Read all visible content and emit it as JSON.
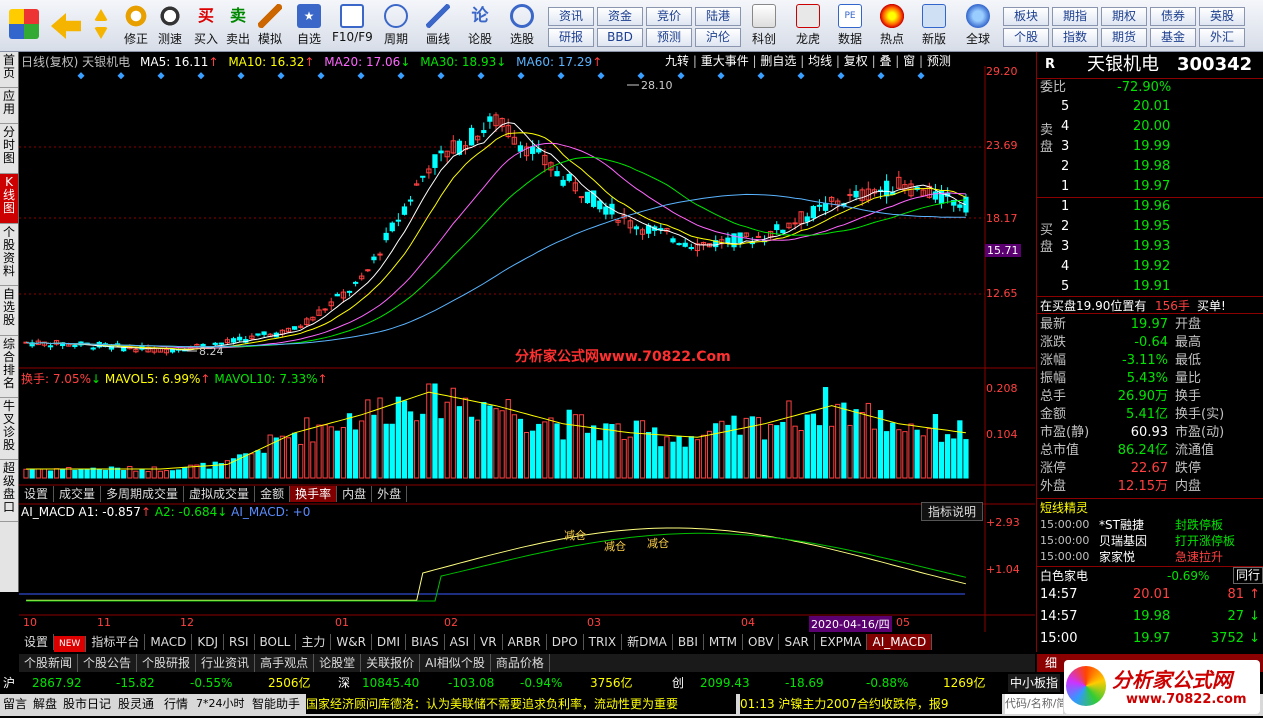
{
  "toolbar": {
    "buttons": [
      "修正",
      "测速",
      "买入",
      "卖出",
      "模拟",
      "自选",
      "F10/F9",
      "周期",
      "画线",
      "论股",
      "选股",
      "科创",
      "龙虎",
      "数据",
      "热点",
      "新版",
      "全球"
    ],
    "quick_row1": [
      "资讯",
      "资金",
      "竞价",
      "陆港",
      "板块",
      "期指",
      "期权",
      "债券",
      "英股"
    ],
    "quick_row2": [
      "研报",
      "BBD",
      "预测",
      "沪伦",
      "个股",
      "指数",
      "期货",
      "基金",
      "外汇"
    ]
  },
  "leftnav": [
    "首页",
    "应用",
    "分时图",
    "K线图",
    "个股资料",
    "自选股",
    "综合排名",
    "牛叉诊股",
    "超级盘口"
  ],
  "chart": {
    "header": {
      "name": "日线(复权) 天银机电",
      "ma5": "MA5: 16.11",
      "ma10": "MA10: 16.32",
      "ma20": "MA20: 17.06",
      "ma30": "MA30: 18.93",
      "ma60": "MA60: 17.29"
    },
    "top_buttons": [
      "九转",
      "重大事件",
      "删自选",
      "均线",
      "复权",
      "叠",
      "窗",
      "预测"
    ],
    "price_axis": [
      "29.20",
      "23.69",
      "18.17",
      "15.71",
      "12.65"
    ],
    "annotations": {
      "high": "28.10",
      "low": "8.24",
      "watermark": "分析家公式网www.70822.Com"
    },
    "volume_header": {
      "a": "换手: 7.05%",
      "b": "MAVOL5: 6.99%",
      "c": "MAVOL10: 7.33%"
    },
    "volume_axis": [
      "0.208",
      "0.104"
    ],
    "volume_tabs": [
      "设置",
      "成交量",
      "多周期成交量",
      "虚拟成交量",
      "金额",
      "换手率",
      "内盘",
      "外盘"
    ],
    "macd_header": {
      "title": "AI_MACD",
      "a1": "A1: -0.857",
      "a2": "A2: -0.684",
      "aim": "AI_MACD: +0"
    },
    "macd_button": "指标说明",
    "macd_axis": [
      "+2.93",
      "+1.04"
    ],
    "macd_labels": [
      "减仓",
      "减仓",
      "减仓"
    ],
    "date_axis": [
      "10",
      "11",
      "12",
      "01",
      "02",
      "03",
      "04",
      "05"
    ],
    "date_highlight": "2020-04-16/四",
    "indicator_tabs": [
      "设置",
      "NEW",
      "指标平台",
      "MACD",
      "KDJ",
      "RSI",
      "BOLL",
      "主力",
      "W&R",
      "DMI",
      "BIAS",
      "ASI",
      "VR",
      "ARBR",
      "DPO",
      "TRIX",
      "新DMA",
      "BBI",
      "MTM",
      "OBV",
      "SAR",
      "EXPMA",
      "AI_MACD"
    ],
    "news_tabs": [
      "个股新闻",
      "个股公告",
      "个股研报",
      "行业资讯",
      "高手观点",
      "论股堂",
      "关联报价",
      "AI相似个股",
      "商品价格"
    ]
  },
  "rpanel": {
    "title": "天银机电",
    "code": "300342",
    "r": "R",
    "weibi_label": "委比",
    "weibi": "-72.90%",
    "sell_label": "卖盘",
    "buy_label": "买盘",
    "asks": [
      {
        "n": "5",
        "p": "20.01"
      },
      {
        "n": "4",
        "p": "20.00"
      },
      {
        "n": "3",
        "p": "19.99"
      },
      {
        "n": "2",
        "p": "19.98"
      },
      {
        "n": "1",
        "p": "19.97"
      }
    ],
    "bids": [
      {
        "n": "1",
        "p": "19.96"
      },
      {
        "n": "2",
        "p": "19.95"
      },
      {
        "n": "3",
        "p": "19.93"
      },
      {
        "n": "4",
        "p": "19.92"
      },
      {
        "n": "5",
        "p": "19.91"
      }
    ],
    "notice": {
      "a": "在买盘19.90位置有",
      "b": "156手",
      "c": "买单!"
    },
    "stats": [
      {
        "l": "最新",
        "v": "19.97",
        "c": "green",
        "l2": "开盘"
      },
      {
        "l": "涨跌",
        "v": "-0.64",
        "c": "green",
        "l2": "最高"
      },
      {
        "l": "涨幅",
        "v": "-3.11%",
        "c": "green",
        "l2": "最低"
      },
      {
        "l": "振幅",
        "v": "5.43%",
        "c": "green",
        "l2": "量比"
      },
      {
        "l": "总手",
        "v": "26.90万",
        "c": "green",
        "l2": "换手"
      },
      {
        "l": "金额",
        "v": "5.41亿",
        "c": "green",
        "l2": "换手(实)"
      },
      {
        "l": "市盈(静)",
        "v": "60.93",
        "c": "white",
        "l2": "市盈(动)"
      },
      {
        "l": "总市值",
        "v": "86.24亿",
        "c": "green",
        "l2": "流通值"
      },
      {
        "l": "涨停",
        "v": "22.67",
        "c": "red",
        "l2": "跌停"
      },
      {
        "l": "外盘",
        "v": "12.15万",
        "c": "red",
        "l2": "内盘"
      }
    ],
    "short_elf": "短线精灵",
    "elf_rows": [
      {
        "t": "15:00:00",
        "n": "*ST融捷",
        "e": "封跌停板",
        "c": "green"
      },
      {
        "t": "15:00:00",
        "n": "贝瑞基因",
        "e": "打开涨停板",
        "c": "green"
      },
      {
        "t": "15:00:00",
        "n": "家家悦",
        "e": "急速拉升",
        "c": "red"
      }
    ],
    "sector": {
      "name": "白色家电",
      "pct": "-0.69%",
      "tab": "同行"
    },
    "ticks": [
      {
        "t": "14:57",
        "p": "20.01",
        "v": "81",
        "c": "red",
        "a": "↑"
      },
      {
        "t": "14:57",
        "p": "19.98",
        "v": "27",
        "c": "green",
        "a": "↓"
      },
      {
        "t": "15:00",
        "p": "19.97",
        "v": "3752",
        "c": "green",
        "a": "↓"
      }
    ],
    "bottom_tabs": [
      "细"
    ],
    "search_hint": "代码/名称/简"
  },
  "market": {
    "sh_label": "沪",
    "sh": "2867.92",
    "sh_chg": "-15.82",
    "sh_pct": "-0.55%",
    "sh_amt": "2506亿",
    "sz_label": "深",
    "sz": "10845.40",
    "sz_chg": "-103.08",
    "sz_pct": "-0.94%",
    "sz_amt": "3756亿",
    "cy_label": "创",
    "cy": "2099.43",
    "cy_chg": "-18.69",
    "cy_pct": "-0.88%",
    "cy_amt": "1269亿",
    "board": "中小板指"
  },
  "bottombar": {
    "items": [
      "留言",
      "解盘",
      "股市日记",
      "股灵通",
      "行情",
      "7*24小时",
      "智能助手"
    ],
    "ticker": "国家经济顾问库德洛：认为美联储不需要追求负利率，流动性更为重要",
    "ticker2": "01:13 沪镍主力2007合约收跌停，报9"
  },
  "logo": "分析家公式网",
  "logo_url": "www.70822.com",
  "colors": {
    "up": "#ff4040",
    "down": "#00ffff",
    "bg": "#000000",
    "accent": "#8b0000"
  },
  "chart_data": {
    "type": "candlestick",
    "x": [
      "10",
      "11",
      "12",
      "01",
      "02",
      "03",
      "04",
      "05"
    ],
    "close": [
      9.2,
      9.0,
      8.6,
      9.2,
      10.2,
      14.0,
      23.0,
      26.5,
      22.0,
      18.5,
      16.8,
      17.5,
      20.0,
      21.5,
      19.97
    ],
    "volume": [
      0.02,
      0.02,
      0.02,
      0.03,
      0.1,
      0.14,
      0.19,
      0.16,
      0.12,
      0.1,
      0.09,
      0.12,
      0.16,
      0.12,
      0.1
    ],
    "ylim": [
      8.0,
      29.2
    ]
  }
}
